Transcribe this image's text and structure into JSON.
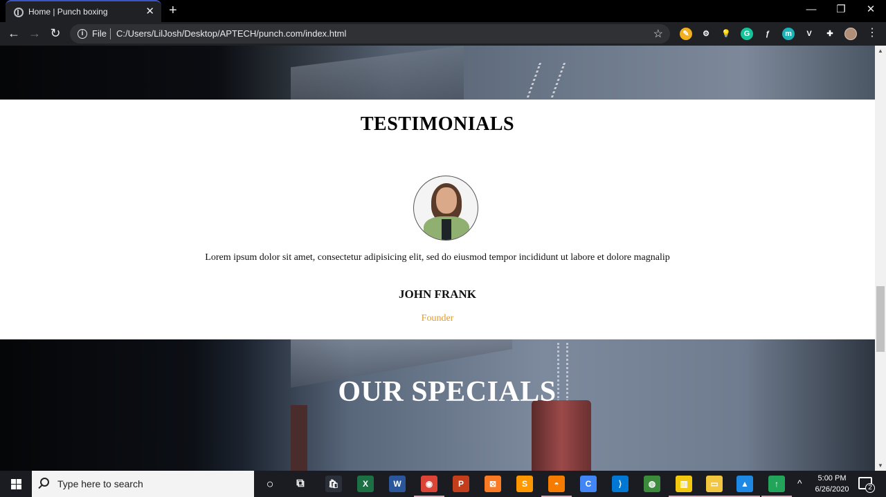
{
  "browser": {
    "tab_title": "Home | Punch boxing",
    "tab_close": "✕",
    "new_tab": "+",
    "window_minimize": "—",
    "window_restore": "❐",
    "window_close": "✕",
    "back": "←",
    "forward": "→",
    "reload": "↻",
    "info": "i",
    "scheme_label": "File",
    "url": "C:/Users/LilJosh/Desktop/APTECH/punch.com/index.html",
    "bookmark": "☆",
    "menu": "⋮",
    "extensions": [
      {
        "icon": "pencil-ext-icon",
        "glyph": "✎",
        "color": "#f2b01e"
      },
      {
        "icon": "gear-ext-icon",
        "glyph": "⚙",
        "color": "#202124"
      },
      {
        "icon": "bulb-ext-icon",
        "glyph": "💡",
        "color": "#202124"
      },
      {
        "icon": "grammarly-ext-icon",
        "glyph": "G",
        "color": "#15c39a"
      },
      {
        "icon": "sketch-ext-icon",
        "glyph": "ƒ",
        "color": "#202124"
      },
      {
        "icon": "m-ext-icon",
        "glyph": "m",
        "color": "#1bb3b8"
      },
      {
        "icon": "vue-ext-icon",
        "glyph": "V",
        "color": "#202124"
      },
      {
        "icon": "puzzle-ext-icon",
        "glyph": "✚",
        "color": "#202124"
      }
    ]
  },
  "page": {
    "testimonials_title": "TESTIMONIALS",
    "quote": "Lorem ipsum dolor sit amet, consectetur adipisicing elit, sed do eiusmod tempor incididunt ut labore et dolore magnalip",
    "person_name": "JOHN FRANK",
    "person_role": "Founder",
    "specials_title": "OUR SPECIALS",
    "accent_color": "#e29a2a"
  },
  "scrollbar": {
    "up": "▲",
    "down": "▼"
  },
  "taskbar": {
    "search_placeholder": "Type here to search",
    "cortana": "○",
    "task_view": "⧉",
    "apps": [
      {
        "icon": "store-icon",
        "glyph": "🛍",
        "color": "#2b2f3a"
      },
      {
        "icon": "excel-icon",
        "glyph": "X",
        "color": "#1d7044"
      },
      {
        "icon": "word-icon",
        "glyph": "W",
        "color": "#2b579a"
      },
      {
        "icon": "chrome-icon",
        "glyph": "◉",
        "color": "#db4437"
      },
      {
        "icon": "powerpoint-icon",
        "glyph": "P",
        "color": "#c43e1c"
      },
      {
        "icon": "xampp-icon",
        "glyph": "⊠",
        "color": "#fb7a24"
      },
      {
        "icon": "sublime-icon",
        "glyph": "S",
        "color": "#ff9800"
      },
      {
        "icon": "uc-browser-icon",
        "glyph": "◓",
        "color": "#f57c00"
      },
      {
        "icon": "chrome-canary-icon",
        "glyph": "C",
        "color": "#4285f4"
      },
      {
        "icon": "vscode-icon",
        "glyph": "⟩",
        "color": "#0078d4"
      },
      {
        "icon": "globe-icon",
        "glyph": "◍",
        "color": "#3c8b3c"
      },
      {
        "icon": "power-bi-icon",
        "glyph": "▥",
        "color": "#f2c811"
      },
      {
        "icon": "file-explorer-icon",
        "glyph": "▭",
        "color": "#f3c640"
      },
      {
        "icon": "photos-icon",
        "glyph": "▲",
        "color": "#1e88e5"
      },
      {
        "icon": "speedtest-icon",
        "glyph": "↑",
        "color": "#22a55b"
      }
    ],
    "tray_chevron": "^",
    "time": "5:00 PM",
    "date": "6/26/2020",
    "notification_count": "2"
  }
}
